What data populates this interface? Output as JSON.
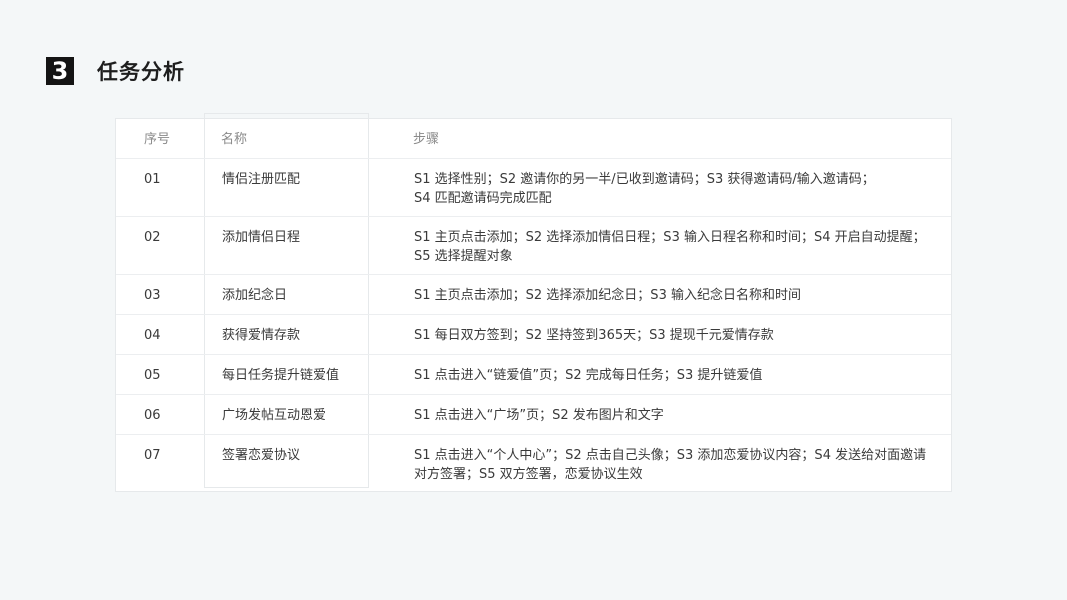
{
  "section": {
    "number": "3",
    "title": "任务分析"
  },
  "table": {
    "headers": {
      "seq": "序号",
      "name": "名称",
      "steps": "步骤"
    },
    "rows": [
      {
        "seq": "01",
        "name": "情侣注册匹配",
        "steps_line1": "S1 选择性别；S2 邀请你的另一半/已收到邀请码；S3 获得邀请码/输入邀请码；",
        "steps_line2": "S4 匹配邀请码完成匹配"
      },
      {
        "seq": "02",
        "name": "添加情侣日程",
        "steps_line1": "S1 主页点击添加；S2 选择添加情侣日程；S3 输入日程名称和时间；S4 开启自动提醒；",
        "steps_line2": "S5 选择提醒对象"
      },
      {
        "seq": "03",
        "name": "添加纪念日",
        "steps_line1": "S1 主页点击添加；S2 选择添加纪念日；S3 输入纪念日名称和时间",
        "steps_line2": ""
      },
      {
        "seq": "04",
        "name": "获得爱情存款",
        "steps_line1": "S1 每日双方签到；S2 坚持签到365天；S3 提现千元爱情存款",
        "steps_line2": ""
      },
      {
        "seq": "05",
        "name": "每日任务提升链爱值",
        "steps_line1": "S1 点击进入“链爱值”页；S2 完成每日任务；S3 提升链爱值",
        "steps_line2": ""
      },
      {
        "seq": "06",
        "name": "广场发帖互动恩爱",
        "steps_line1": "S1 点击进入“广场”页；S2 发布图片和文字",
        "steps_line2": ""
      },
      {
        "seq": "07",
        "name": "签署恋爱协议",
        "steps_line1": "S1 点击进入“个人中心”；S2 点击自己头像；S3 添加恋爱协议内容；S4 发送给对面邀请",
        "steps_line2": "对方签署；S5 双方签署，恋爱协议生效"
      }
    ]
  }
}
